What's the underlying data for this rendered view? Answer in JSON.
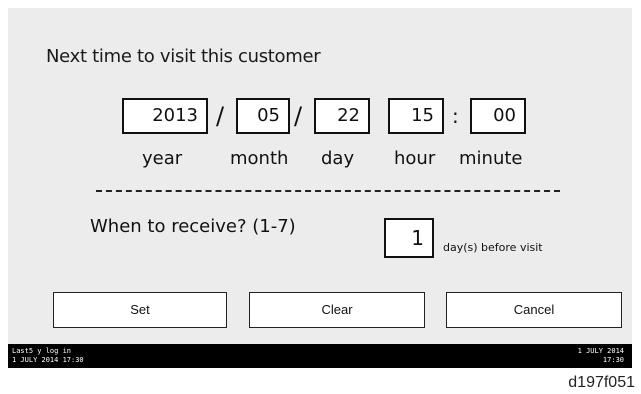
{
  "prompt": "Next time to visit this customer",
  "date_fields": {
    "year": "2013",
    "month": "05",
    "day": "22",
    "hour": "15",
    "minute": "00",
    "date_separator": "/",
    "time_separator": ":"
  },
  "units": {
    "year": "year",
    "month": "month",
    "day": "day",
    "hour": "hour",
    "minute": "minute"
  },
  "receive": {
    "label": "When to receive? (1-7)",
    "value": "1",
    "suffix": "day(s) before visit"
  },
  "buttons": {
    "set": "Set",
    "clear": "Clear",
    "cancel": "Cancel"
  },
  "status_bar": {
    "left_line1": "Last5 y log in",
    "left_line2": "1 JULY 2014 17:30",
    "right_line1": "1 JULY 2014",
    "right_line2": "17:30"
  },
  "figure_id": "d197f051"
}
